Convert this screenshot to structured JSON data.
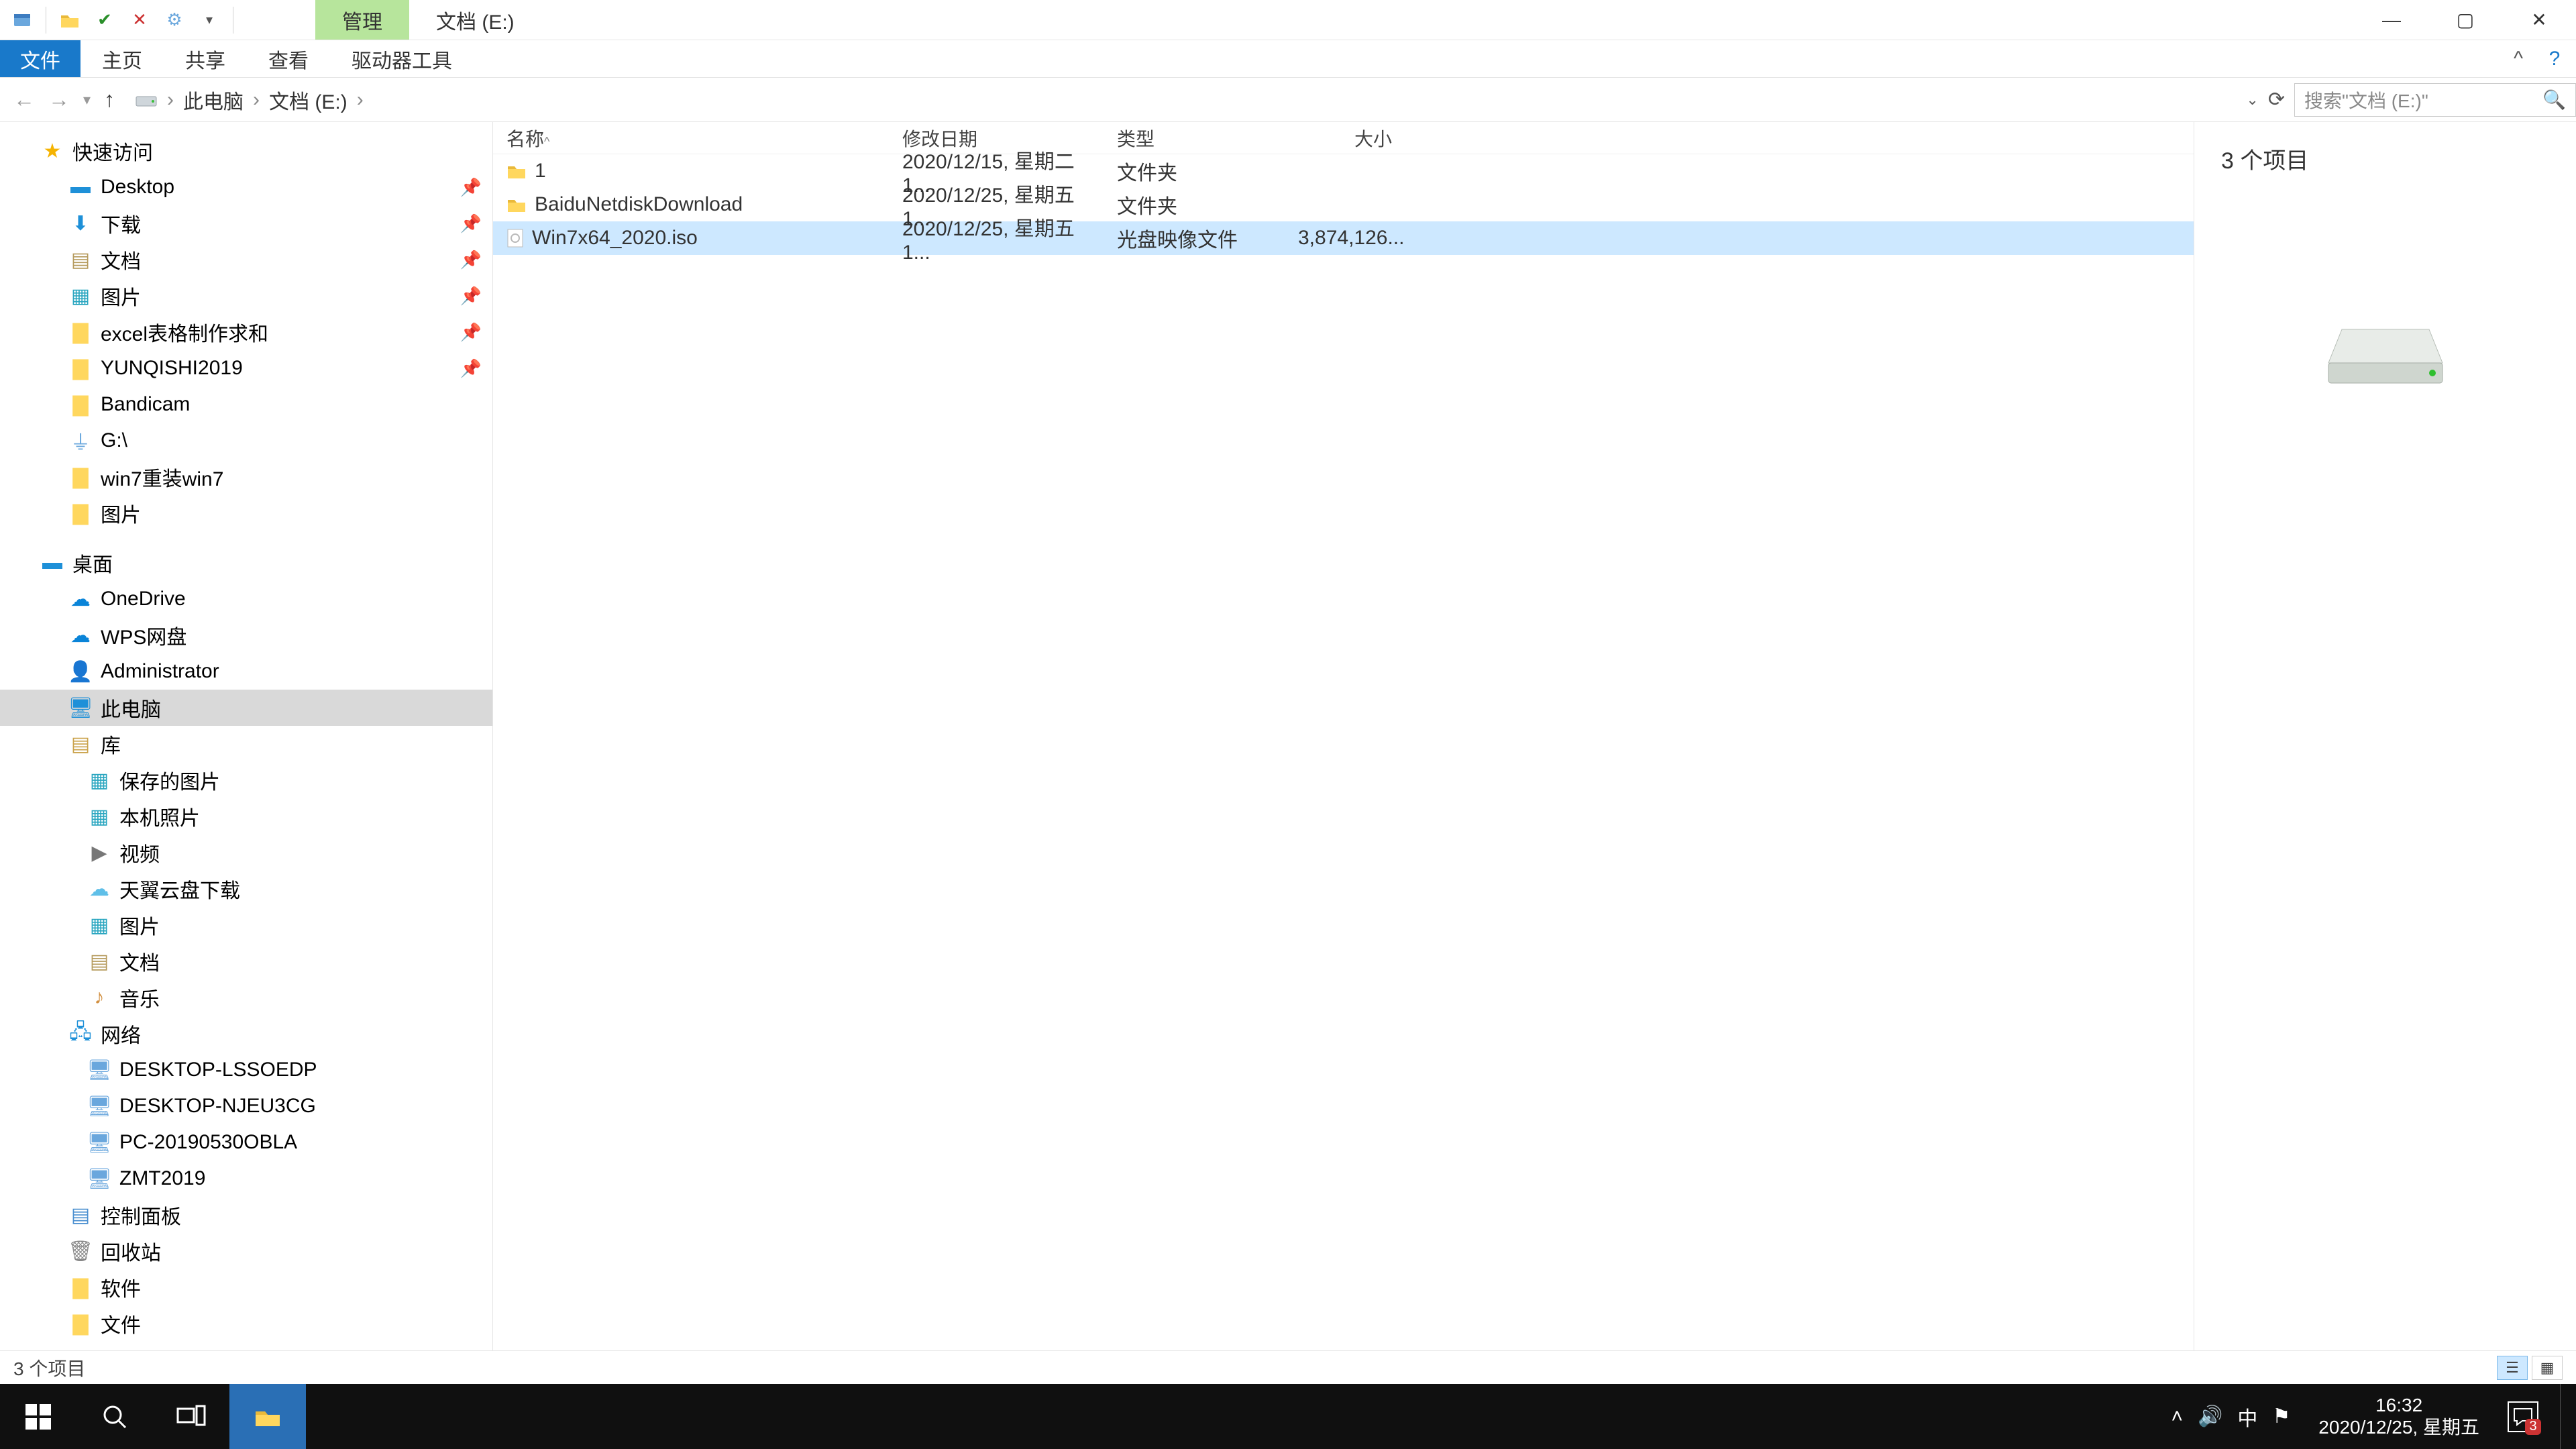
{
  "window": {
    "manage_tab": "管理",
    "title": "文档 (E:)",
    "min": "—",
    "max": "▢",
    "close": "✕"
  },
  "ribbon": {
    "file": "文件",
    "home": "主页",
    "share": "共享",
    "view": "查看",
    "drive_tools": "驱动器工具"
  },
  "breadcrumb": {
    "this_pc": "此电脑",
    "drive": "文档 (E:)",
    "arrow": "›"
  },
  "search": {
    "placeholder": "搜索\"文档 (E:)\""
  },
  "tree": {
    "quick_access": "快速访问",
    "desktop": "Desktop",
    "downloads": "下载",
    "documents": "文档",
    "pictures": "图片",
    "excel": "excel表格制作求和",
    "yunqishi": "YUNQISHI2019",
    "bandicam": "Bandicam",
    "gdrive": "G:\\",
    "win7reinstall": "win7重装win7",
    "pictures2": "图片",
    "desktop_cn": "桌面",
    "onedrive": "OneDrive",
    "wps": "WPS网盘",
    "admin": "Administrator",
    "this_pc": "此电脑",
    "library": "库",
    "saved_pics": "保存的图片",
    "camera_roll": "本机照片",
    "videos": "视频",
    "tianyicloud": "天翼云盘下载",
    "pics_lib": "图片",
    "docs_lib": "文档",
    "music": "音乐",
    "network": "网络",
    "pc1": "DESKTOP-LSSOEDP",
    "pc2": "DESKTOP-NJEU3CG",
    "pc3": "PC-20190530OBLA",
    "pc4": "ZMT2019",
    "control_panel": "控制面板",
    "recycle": "回收站",
    "software": "软件",
    "files": "文件"
  },
  "columns": {
    "name": "名称",
    "date": "修改日期",
    "type": "类型",
    "size": "大小"
  },
  "rows": [
    {
      "name": "1",
      "date": "2020/12/15, 星期二 1...",
      "type": "文件夹",
      "size": "",
      "icon": "folder",
      "selected": false
    },
    {
      "name": "BaiduNetdiskDownload",
      "date": "2020/12/25, 星期五 1...",
      "type": "文件夹",
      "size": "",
      "icon": "folder",
      "selected": false
    },
    {
      "name": "Win7x64_2020.iso",
      "date": "2020/12/25, 星期五 1...",
      "type": "光盘映像文件",
      "size": "3,874,126...",
      "icon": "iso",
      "selected": true
    }
  ],
  "preview": {
    "count_label": "3 个项目"
  },
  "statusbar": {
    "count": "3 个项目"
  },
  "taskbar": {
    "time": "16:32",
    "date": "2020/12/25, 星期五",
    "ime": "中",
    "notif_count": "3"
  },
  "colors": {
    "accent": "#1979ca",
    "green_tab": "#b7e59c",
    "selection": "#cde8ff"
  }
}
